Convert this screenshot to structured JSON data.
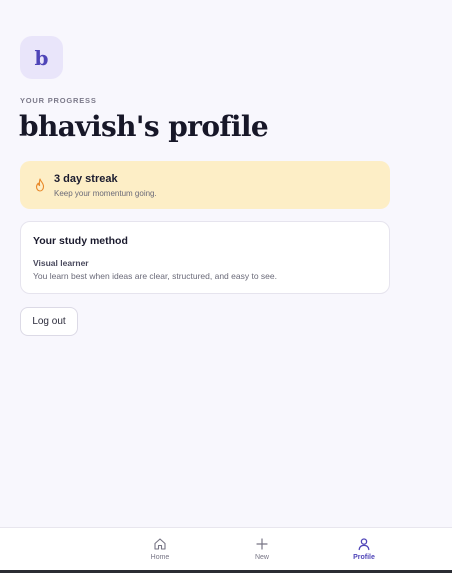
{
  "avatar": {
    "initial": "b"
  },
  "header": {
    "eyebrow": "YOUR PROGRESS",
    "title": "bhavish's profile"
  },
  "streak": {
    "title": "3 day streak",
    "subtitle": "Keep your momentum going.",
    "icon": "flame-icon",
    "color": "#e8892a"
  },
  "study_method": {
    "title": "Your study method",
    "type": "Visual learner",
    "description": "You learn best when ideas are clear, structured, and easy to see."
  },
  "logout": {
    "label": "Log out"
  },
  "nav": {
    "items": [
      {
        "label": "Home",
        "icon": "home-icon",
        "active": false
      },
      {
        "label": "New",
        "icon": "plus-icon",
        "active": false
      },
      {
        "label": "Profile",
        "icon": "user-icon",
        "active": true
      }
    ],
    "accent": "#4f45b8"
  }
}
